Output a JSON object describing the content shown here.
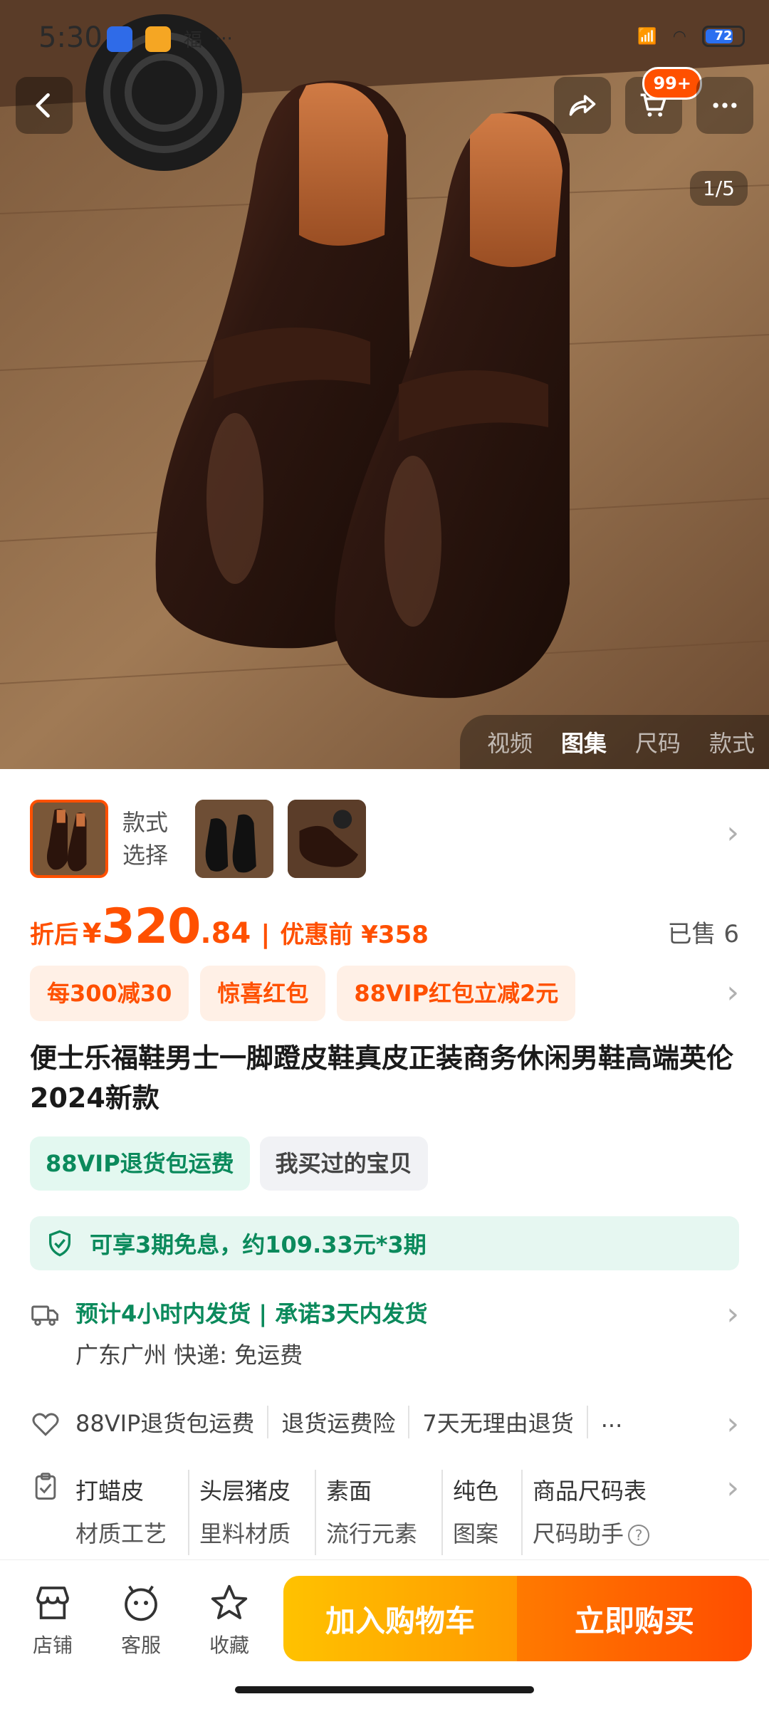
{
  "status_bar": {
    "time": "5:30",
    "app_text": "福",
    "more": "···",
    "battery": "72"
  },
  "nav": {
    "cart_badge": "99+"
  },
  "gallery": {
    "counter": "1/5",
    "tabs": [
      "视频",
      "图集",
      "尺码",
      "款式"
    ],
    "active_tab": "图集"
  },
  "styles": {
    "label": "款式选择"
  },
  "price": {
    "label": "折后",
    "currency": "¥",
    "integer": "320",
    "decimal": ".84",
    "separator": "|",
    "before_label": "优惠前 ¥358",
    "sold": "已售 6"
  },
  "promos": [
    "每300减30",
    "惊喜红包",
    "88VIP红包立减2元"
  ],
  "title": "便士乐福鞋男士一脚蹬皮鞋真皮正装商务休闲男鞋高端英伦2024新款",
  "tags": [
    "88VIP退货包运费",
    "我买过的宝贝"
  ],
  "installment": "可享3期免息，约109.33元*3期",
  "shipping": {
    "line1": "预计4小时内发货 | 承诺3天内发货",
    "line2": "广东广州  快递: 免运费"
  },
  "services": [
    "88VIP退货包运费",
    "退货运费险",
    "7天无理由退货",
    "..."
  ],
  "attributes": [
    {
      "value": "打蜡皮",
      "key": "材质工艺"
    },
    {
      "value": "头层猪皮",
      "key": "里料材质"
    },
    {
      "value": "素面",
      "key": "流行元素"
    },
    {
      "value": "纯色",
      "key": "图案"
    }
  ],
  "size_links": {
    "chart": "商品尺码表",
    "helper": "尺码助手"
  },
  "bottom_bar": {
    "shop": "店铺",
    "service": "客服",
    "favorite": "收藏",
    "add_to_cart": "加入购物车",
    "buy_now": "立即购买"
  },
  "colors": {
    "accent": "#ff5000",
    "green": "#0b8a5c",
    "cart_grad_start": "#ffc200",
    "buy_grad_end": "#ff4d00"
  }
}
